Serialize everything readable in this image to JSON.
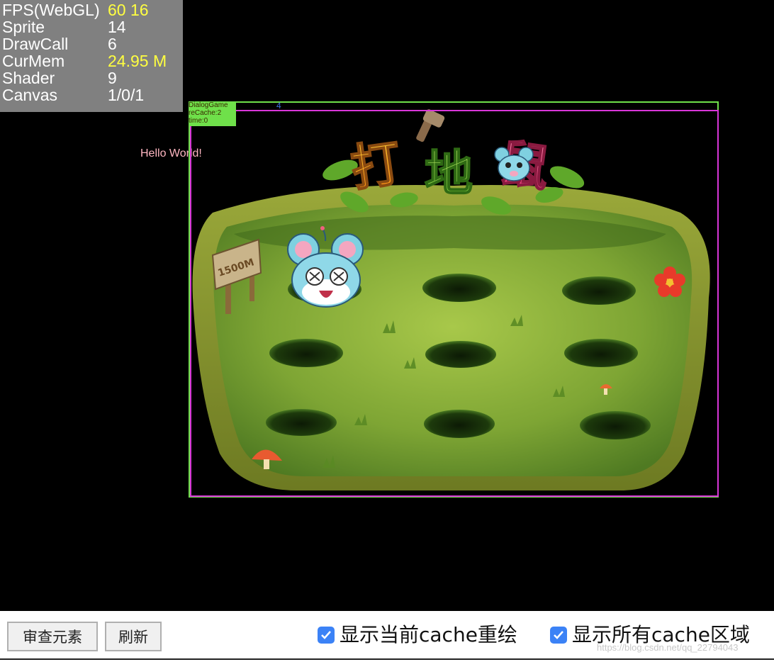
{
  "stats": [
    {
      "label": "FPS(WebGL)",
      "value": "60 16",
      "highlight": true
    },
    {
      "label": "Sprite",
      "value": "14",
      "highlight": false
    },
    {
      "label": "DrawCall",
      "value": "6",
      "highlight": false
    },
    {
      "label": "CurMem",
      "value": "24.95 M",
      "highlight": true
    },
    {
      "label": "Shader",
      "value": "9",
      "highlight": false
    },
    {
      "label": "Canvas",
      "value": "1/0/1",
      "highlight": false
    }
  ],
  "hello_text": "Hello World!",
  "cache_tag": {
    "line1": "DialogGame",
    "line2": "reCache:2",
    "line3": "time:0"
  },
  "marker": "4",
  "game": {
    "title": "打地鼠",
    "sign_text": "1500M"
  },
  "toolbar": {
    "inspect_label": "审查元素",
    "refresh_label": "刷新",
    "show_current_cache_label": "显示当前cache重绘",
    "show_current_cache_checked": true,
    "show_all_cache_label": "显示所有cache区域",
    "show_all_cache_checked": true,
    "watermark": "https://blog.csdn.net/qq_22794043"
  },
  "colors": {
    "stats_bg": "#808080",
    "highlight": "#ffff40",
    "frame_green": "#6fe04a",
    "frame_magenta": "#d836d8",
    "checkbox": "#3b82f6"
  }
}
